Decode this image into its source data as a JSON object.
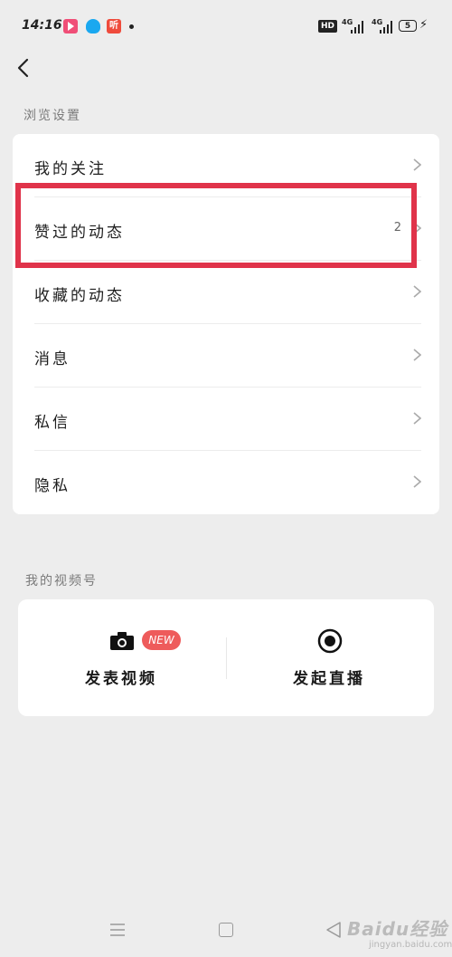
{
  "status_bar": {
    "time": "14:16",
    "listen_app_label": "听",
    "hd_label": "HD",
    "signal1_label": "4G",
    "signal2_label": "4G",
    "battery_level": "5"
  },
  "browse_section": {
    "label": "浏览设置",
    "items": [
      {
        "label": "我的关注",
        "count": ""
      },
      {
        "label": "赞过的动态",
        "count": "2"
      },
      {
        "label": "收藏的动态",
        "count": ""
      },
      {
        "label": "消息",
        "count": ""
      },
      {
        "label": "私信",
        "count": ""
      },
      {
        "label": "隐私",
        "count": ""
      }
    ]
  },
  "channel_section": {
    "label": "我的视频号",
    "publish_video_label": "发表视频",
    "new_badge": "NEW",
    "go_live_label": "发起直播"
  },
  "watermark": {
    "text": "Baidu经验",
    "sub": "jingyan.baidu.com"
  },
  "colors": {
    "highlight": "#e0334a",
    "new_badge": "#ee5b5b",
    "background": "#ededed"
  }
}
